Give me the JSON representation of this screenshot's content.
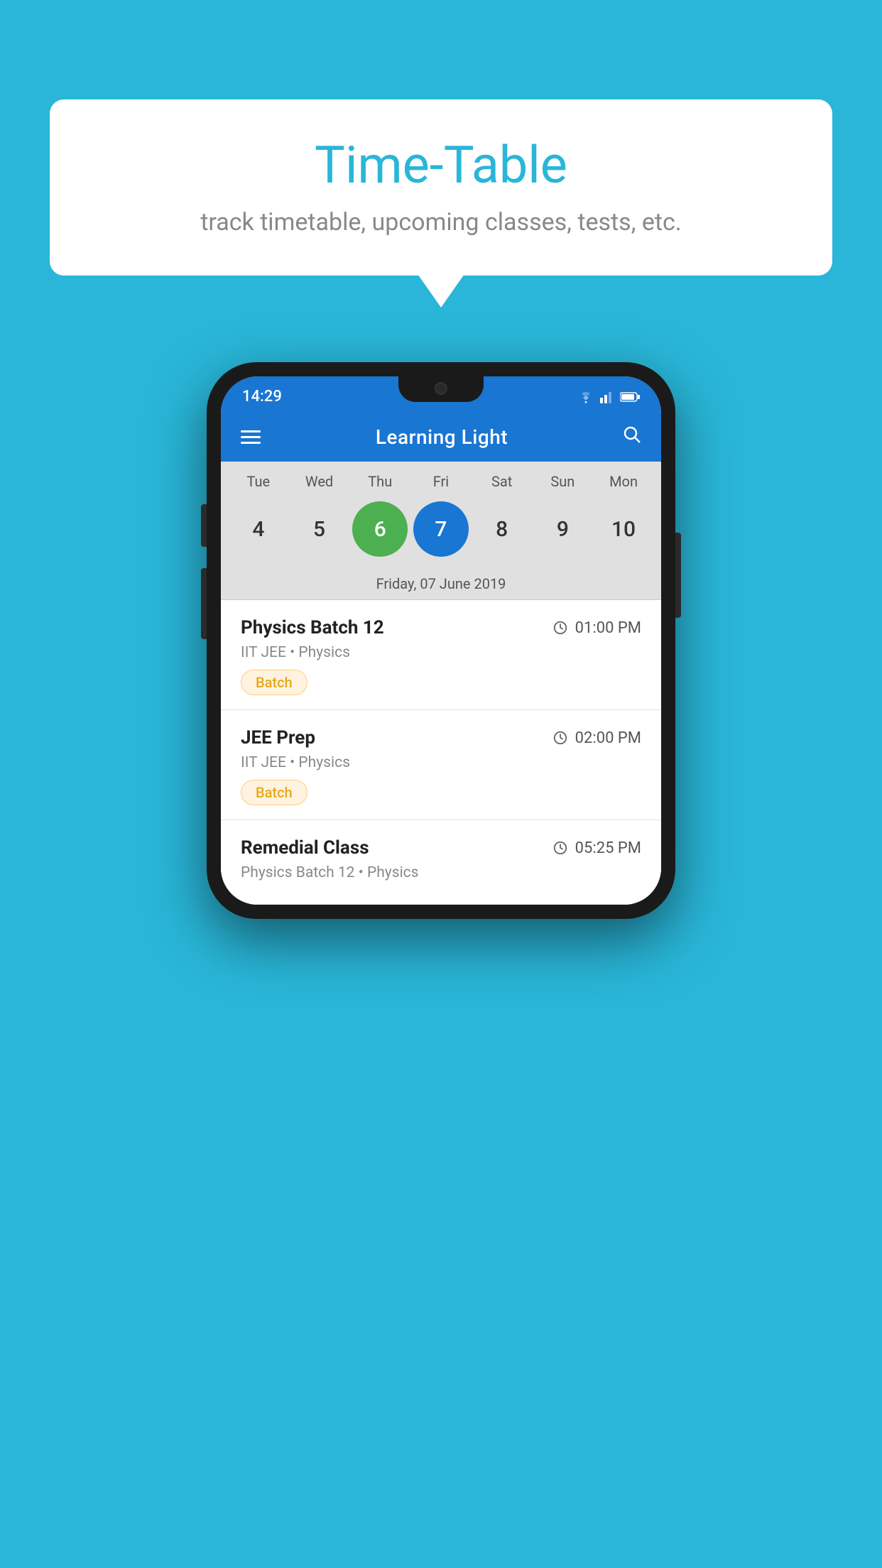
{
  "background_color": "#29b6d8",
  "bubble": {
    "title": "Time-Table",
    "subtitle": "track timetable, upcoming classes, tests, etc."
  },
  "phone": {
    "status_bar": {
      "time": "14:29"
    },
    "app_bar": {
      "title": "Learning Light"
    },
    "calendar": {
      "days": [
        "Tue",
        "Wed",
        "Thu",
        "Fri",
        "Sat",
        "Sun",
        "Mon"
      ],
      "dates": [
        "4",
        "5",
        "6",
        "7",
        "8",
        "9",
        "10"
      ],
      "today_index": 2,
      "selected_index": 3,
      "selected_label": "Friday, 07 June 2019"
    },
    "classes": [
      {
        "name": "Physics Batch 12",
        "time": "01:00 PM",
        "subtitle": "IIT JEE • Physics",
        "tag": "Batch"
      },
      {
        "name": "JEE Prep",
        "time": "02:00 PM",
        "subtitle": "IIT JEE • Physics",
        "tag": "Batch"
      },
      {
        "name": "Remedial Class",
        "time": "05:25 PM",
        "subtitle": "Physics Batch 12 • Physics",
        "tag": null
      }
    ]
  }
}
